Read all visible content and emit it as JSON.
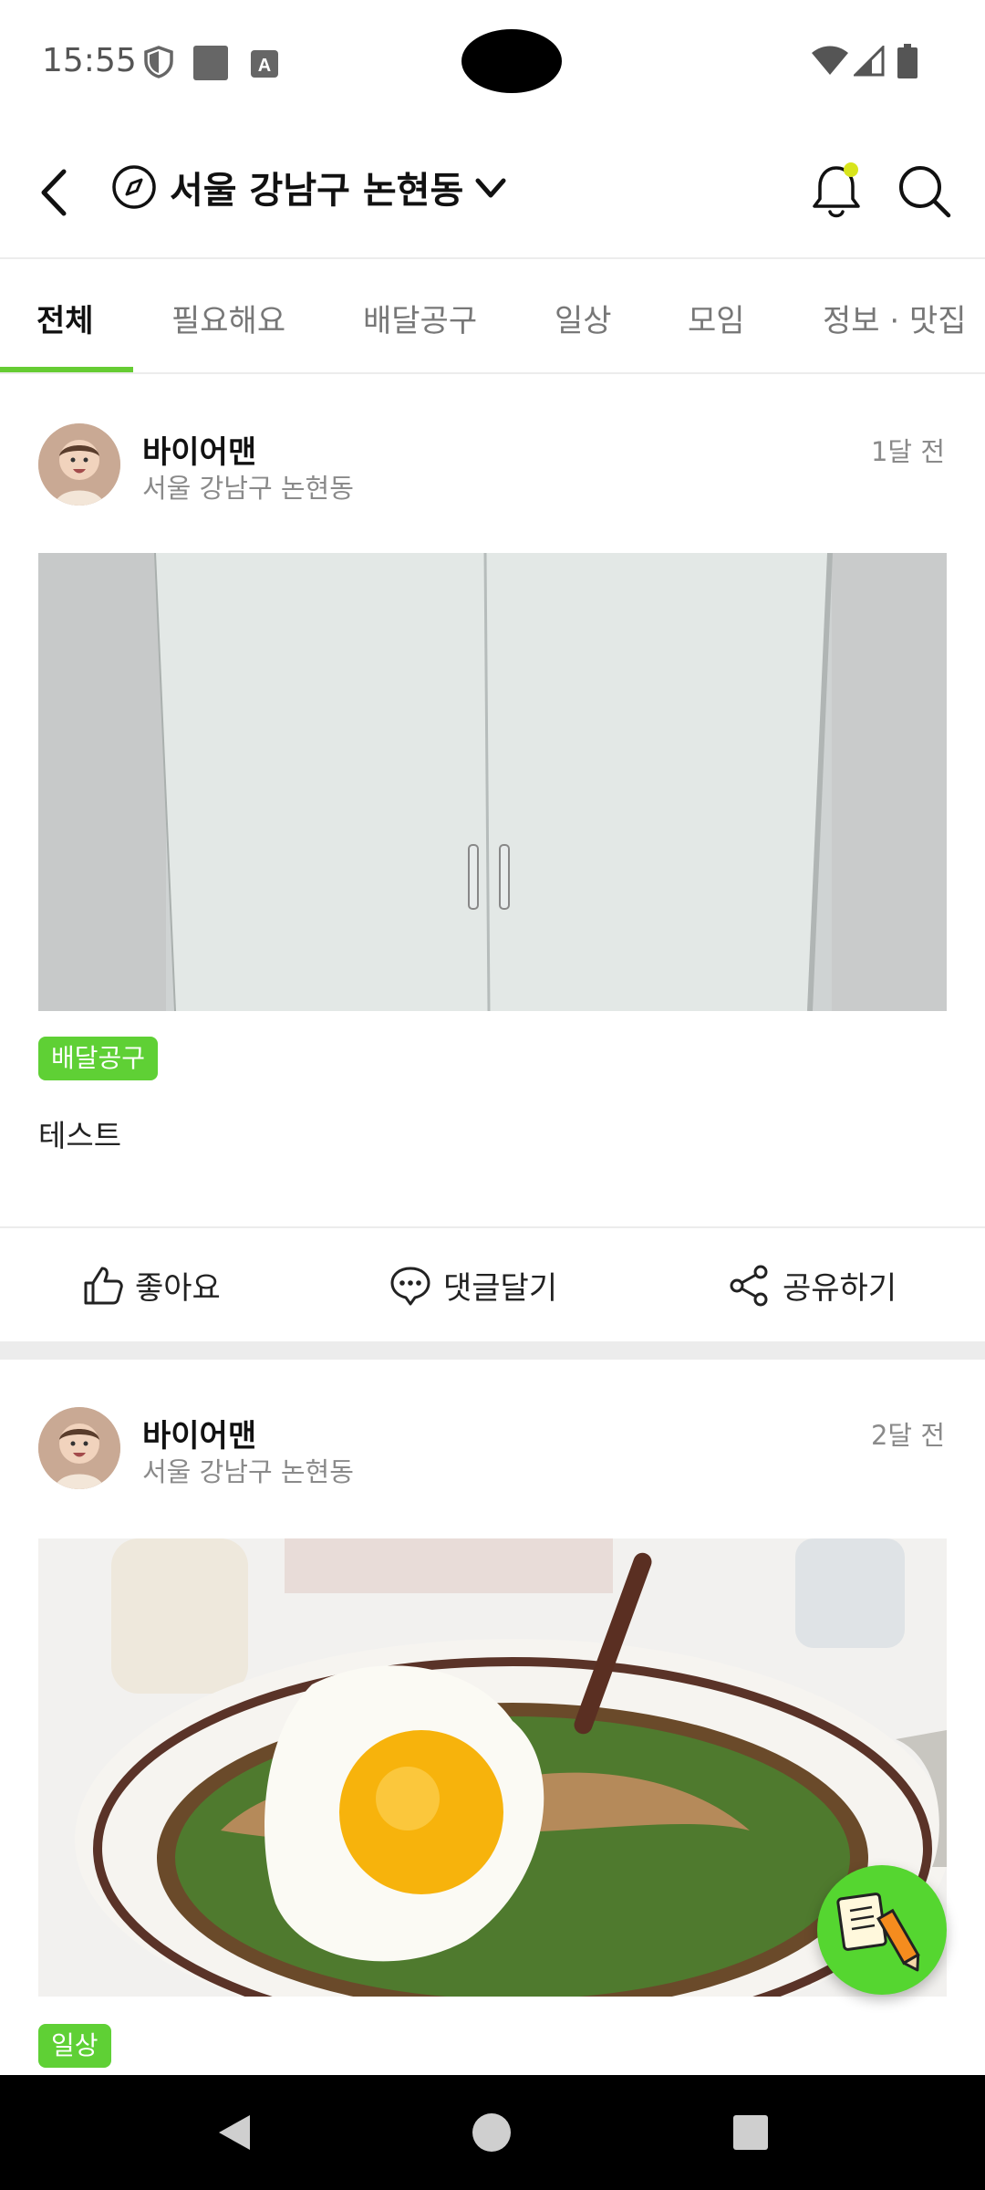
{
  "status_bar": {
    "time": "15:55",
    "icons": [
      "shield-icon",
      "square-notification-icon",
      "a-notification-icon",
      "wifi-icon",
      "signal-icon",
      "battery-icon"
    ]
  },
  "header": {
    "location_title": "서울 강남구 논현동",
    "icons": [
      "back-arrow-icon",
      "compass-icon",
      "chevron-down-icon",
      "bell-icon",
      "search-icon"
    ],
    "notification_dot_color": "#d8e41c"
  },
  "tabs": [
    {
      "label": "전체",
      "active": true
    },
    {
      "label": "필요해요",
      "active": false
    },
    {
      "label": "배달공구",
      "active": false
    },
    {
      "label": "일상",
      "active": false
    },
    {
      "label": "모임",
      "active": false
    },
    {
      "label": "정보 · 맛집",
      "active": false
    }
  ],
  "accent_color": "#66cc33",
  "posts": [
    {
      "author": "바이어맨",
      "location": "서울 강남구 논현동",
      "time": "1달 전",
      "badge": "배달공구",
      "text": "테스트",
      "image": "white-cabinet-doors-photo"
    },
    {
      "author": "바이어맨",
      "location": "서울 강남구 논현동",
      "time": "2달 전",
      "badge": "일상",
      "image": "okonomiyaki-with-fried-egg-photo"
    }
  ],
  "actions": {
    "like": "좋아요",
    "comment": "댓글달기",
    "share": "공유하기"
  },
  "fab": {
    "icon": "write-post-icon",
    "color": "#55d630"
  },
  "nav_bar": {
    "icons": [
      "nav-back-icon",
      "nav-home-icon",
      "nav-recents-icon"
    ]
  }
}
